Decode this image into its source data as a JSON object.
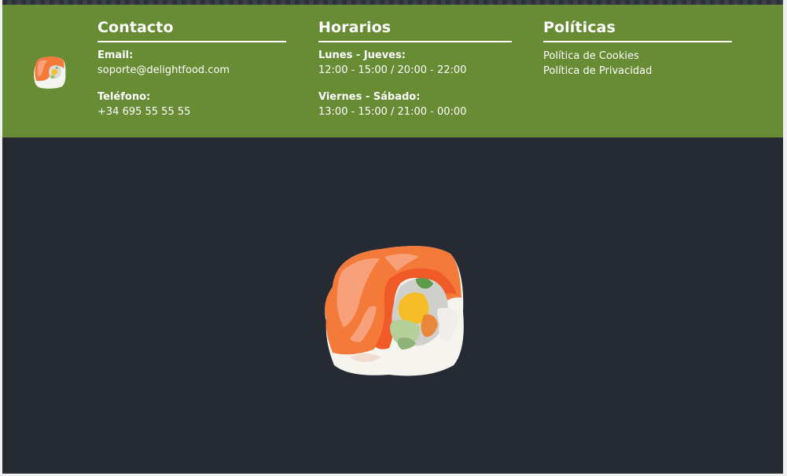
{
  "footer": {
    "contact": {
      "title": "Contacto",
      "email_label": "Email:",
      "email_value": "soporte@delightfood.com",
      "phone_label": "Teléfono:",
      "phone_value": "+34 695 55 55 55"
    },
    "hours": {
      "title": "Horarios",
      "weekday_label": "Lunes - Jueves:",
      "weekday_value": "12:00 - 15:00 / 20:00 - 22:00",
      "weekend_label": "Viernes - Sábado:",
      "weekend_value": "13:00 - 15:00 / 21:00 - 00:00"
    },
    "policies": {
      "title": "Políticas",
      "links": [
        "Política de Cookies",
        "Política de Privacidad"
      ]
    }
  },
  "colors": {
    "footer_bg": "#678c34",
    "page_bg": "#252a33",
    "text": "#ffffff",
    "salmon": "#f47a3a"
  },
  "icons": {
    "footer_logo": "sushi-roll-icon",
    "hero_logo": "sushi-roll-icon"
  }
}
